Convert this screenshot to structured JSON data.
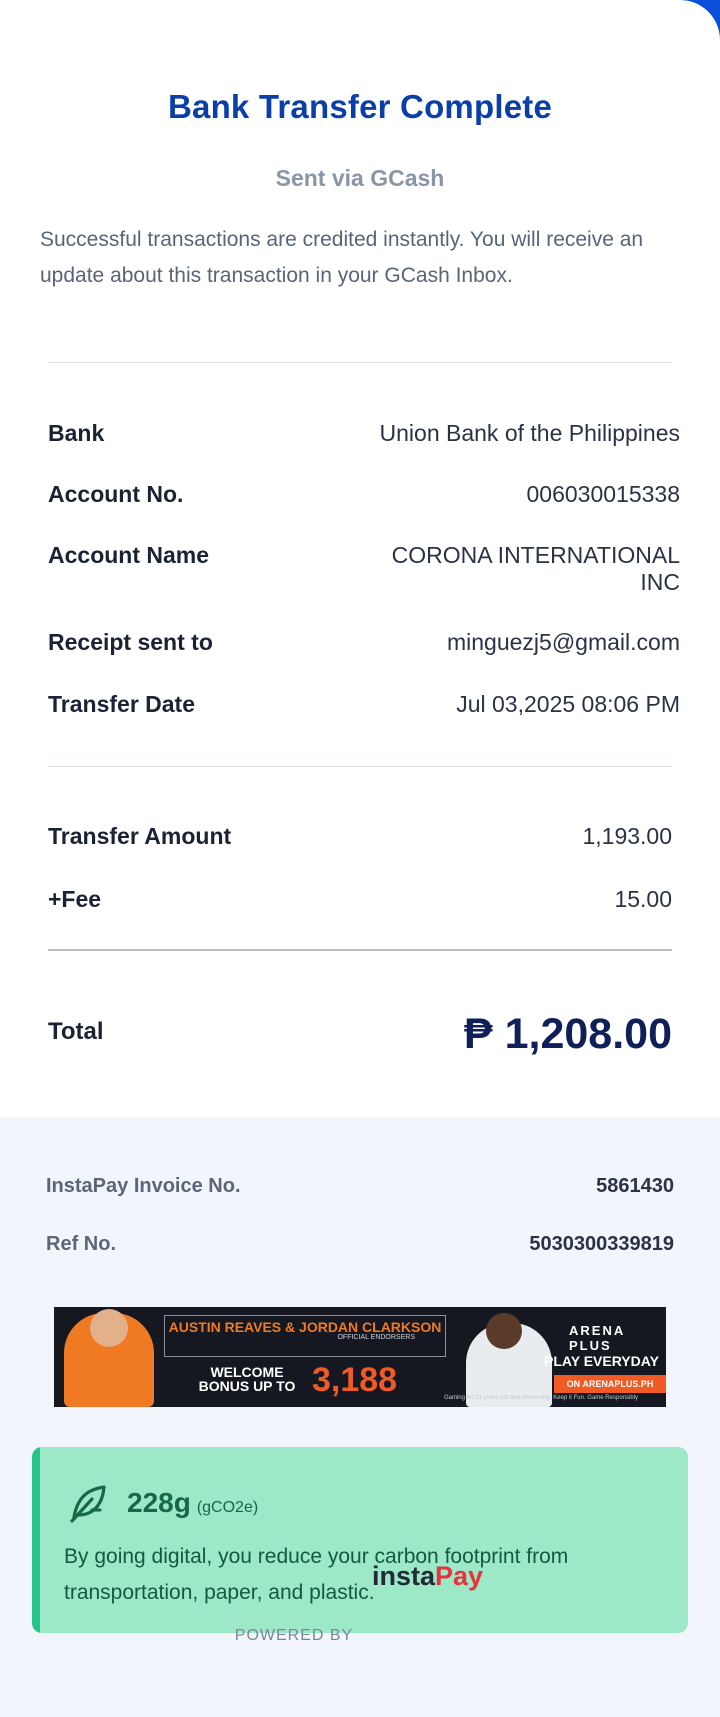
{
  "header": {
    "title": "Bank Transfer Complete",
    "subtitle": "Sent via GCash",
    "info": "Successful transactions are credited instantly. You will receive an update about this transaction in your GCash Inbox."
  },
  "details": [
    {
      "label": "Bank",
      "value": "Union Bank of the Philippines"
    },
    {
      "label": "Account No.",
      "value": "006030015338"
    },
    {
      "label": "Account Name",
      "value": "CORONA INTERNATIONAL INC"
    },
    {
      "label": "Receipt sent to",
      "value": "minguezj5@gmail.com"
    },
    {
      "label": "Transfer Date",
      "value": "Jul 03,2025 08:06 PM"
    }
  ],
  "amounts": {
    "transfer_label": "Transfer Amount",
    "transfer_value": "1,193.00",
    "fee_label": "+Fee",
    "fee_value": "15.00"
  },
  "total": {
    "label": "Total",
    "currency": "₱",
    "value": "1,208.00"
  },
  "references": {
    "invoice_label": "InstaPay Invoice No.",
    "invoice_value": "5861430",
    "ref_label": "Ref No.",
    "ref_value": "5030300339819"
  },
  "banner": {
    "names": "AUSTIN REAVES & JORDAN CLARKSON",
    "endorsers": "OFFICIAL ENDORSERS",
    "welcome": "WELCOME BONUS UP TO",
    "bonus": "3,188",
    "brand": "ARENA PLUS",
    "play": "PLAY EVERYDAY",
    "url": "ON ARENAPLUS.PH",
    "disclaimer": "Gaming for 21 years old and above only. Keep it Fun. Game Responsibly"
  },
  "eco": {
    "value": "228g",
    "unit": "(gCO2e)",
    "text": "By going digital, you reduce your carbon footprint from transportation, paper, and plastic.",
    "icon": "leaf-icon"
  },
  "footer": {
    "powered_by": "POWERED BY",
    "logo_insta": "insta",
    "logo_pay": "Pay"
  },
  "colors": {
    "title": "#0b3fa8",
    "total": "#0e2057",
    "eco_bg": "#9ce8c7",
    "eco_accent": "#27c48a",
    "accent_blue": "#0a4fd8",
    "instapay_red": "#e8323c"
  }
}
